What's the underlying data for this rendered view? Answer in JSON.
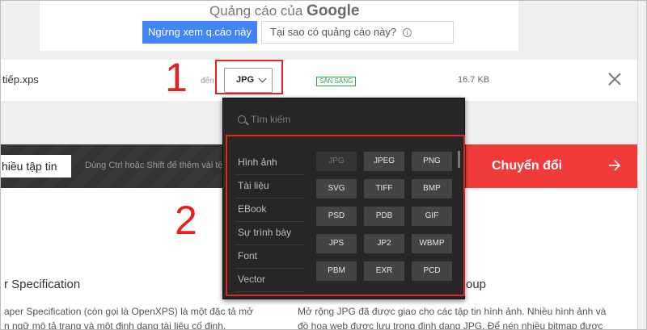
{
  "ad": {
    "label": "Quảng cáo của",
    "brand": "Google",
    "stop_button": "Ngừng xem q.cáo này",
    "why_button": "Tại sao có quảng cáo này?",
    "info_symbol": "i"
  },
  "file": {
    "name": "tiếp.xps",
    "to_label": "đến",
    "selected_format": "JPG",
    "status": "SẴN SÀNG",
    "size": "16.7 KB"
  },
  "annotations": {
    "step1": "1",
    "step2": "2"
  },
  "toolbar": {
    "add_files": "hiều tập tin",
    "hint": "Dùng Ctrl hoặc Shift để thêm vài tệp",
    "convert": "Chuyển đổi"
  },
  "dropdown": {
    "search_placeholder": "Tìm kiếm",
    "categories": [
      "Hình ảnh",
      "Tài liệu",
      "EBook",
      "Sự trình bày",
      "Font",
      "Vector"
    ],
    "formats": [
      "JPG",
      "JPEG",
      "PNG",
      "SVG",
      "TIFF",
      "BMP",
      "PSD",
      "PDB",
      "GIF",
      "JPS",
      "JP2",
      "WBMP",
      "PBM",
      "EXR",
      "PCD"
    ]
  },
  "content": {
    "spec_title": "r Specification",
    "spec_p1": "aper Specification (còn gọi là OpenXPS) là một đặc tả mở",
    "spec_p2": "n ngữ mô tả trang và một định dạng tài liệu cố định.",
    "group_title": "oup",
    "group_p1": "Mở rộng JPG đã được giao cho các tập tin hình ảnh. Nhiều hình ảnh và",
    "group_p2": "đồ họa web được lưu trong định dạng JPG. Để nén nhiều bitmap được"
  },
  "colors": {
    "accent_red": "#f03b3b",
    "ad_blue": "#4285f4",
    "ready_green": "#2fa44f",
    "annotation_red": "#e32222"
  }
}
